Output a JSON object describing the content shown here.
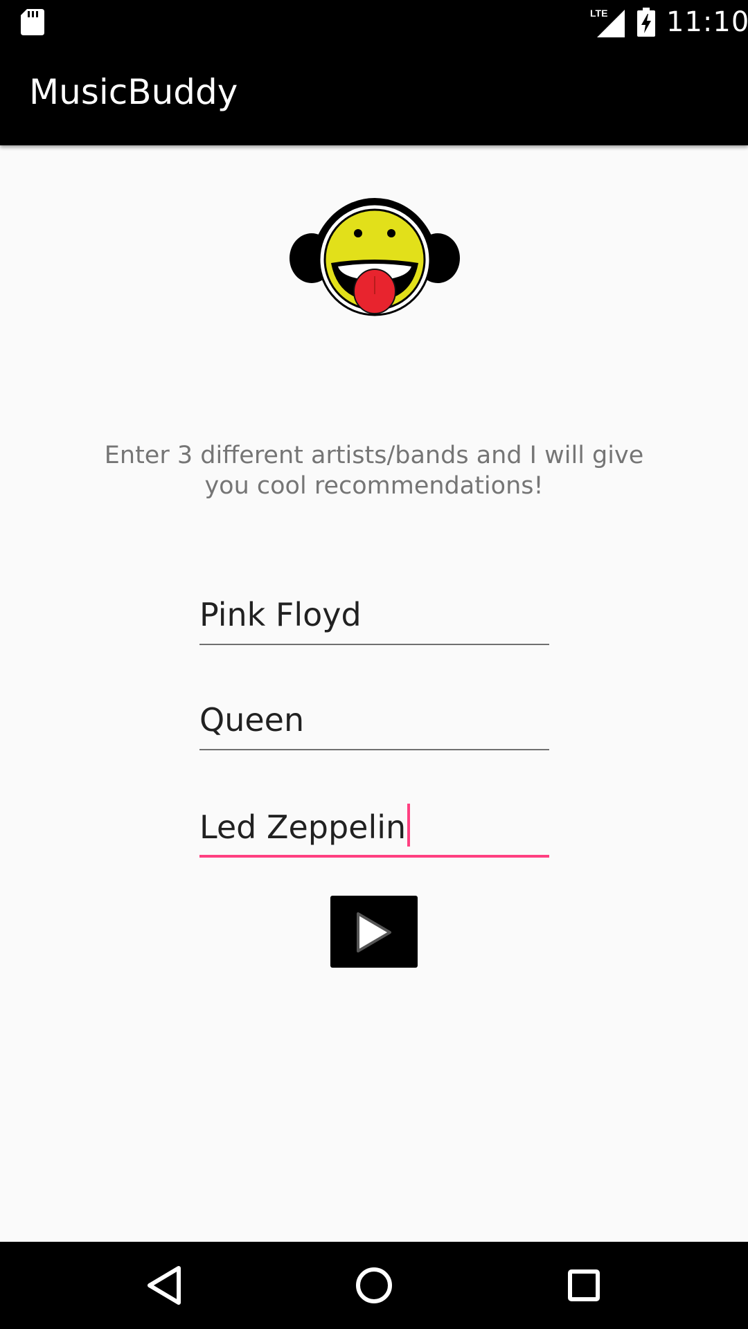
{
  "status_bar": {
    "time": "11:10",
    "network_label": "LTE",
    "icons": [
      "sd-card-icon",
      "lte-signal-icon",
      "battery-charging-icon"
    ]
  },
  "app_bar": {
    "title": "MusicBuddy"
  },
  "logo": {
    "icon": "smiley-headphones-logo"
  },
  "instructions": "Enter 3 different artists/bands and I will give you cool recommendations!",
  "inputs": [
    {
      "value": "Pink Floyd",
      "focused": false
    },
    {
      "value": "Queen",
      "focused": false
    },
    {
      "value": "Led Zeppelin",
      "focused": true
    }
  ],
  "submit_button": {
    "icon": "play-icon"
  },
  "nav_bar": {
    "icons": [
      "back-icon",
      "home-icon",
      "recents-icon"
    ]
  },
  "colors": {
    "accent": "#ff4081",
    "app_bar": "#000000",
    "background": "#fafafa",
    "hint_text": "#757575",
    "logo_face": "#e2e01a",
    "logo_tongue": "#e8242e"
  }
}
